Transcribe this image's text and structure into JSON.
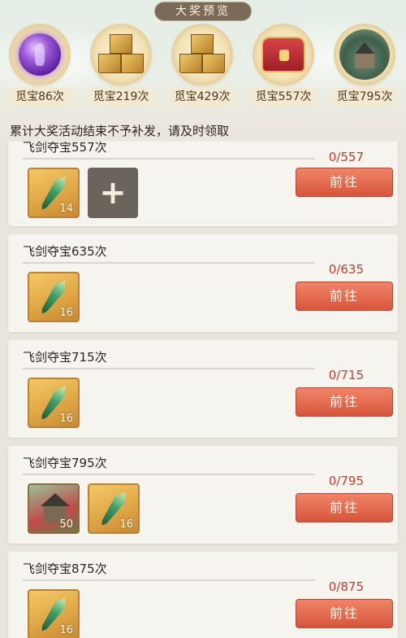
{
  "header": {
    "title": "大奖预览"
  },
  "prizes": [
    {
      "icon": "purple-orb-icon",
      "label": "觅宝86次"
    },
    {
      "icon": "gold-crates-icon",
      "label": "觅宝219次"
    },
    {
      "icon": "gold-crates-icon",
      "label": "觅宝429次"
    },
    {
      "icon": "red-chest-icon",
      "label": "觅宝557次"
    },
    {
      "icon": "pavilion-house-icon",
      "label": "觅宝795次"
    }
  ],
  "notice": "累计大奖活动结束不予补发，请及时领取",
  "tasks": [
    {
      "name": "飞剑夺宝557次",
      "progress": "0/557",
      "button": "前往",
      "items": [
        {
          "icon": "flying-sword-icon",
          "count": "14"
        }
      ],
      "add_slot": "+"
    },
    {
      "name": "飞剑夺宝635次",
      "progress": "0/635",
      "button": "前往",
      "items": [
        {
          "icon": "flying-sword-icon",
          "count": "16"
        }
      ]
    },
    {
      "name": "飞剑夺宝715次",
      "progress": "0/715",
      "button": "前往",
      "items": [
        {
          "icon": "flying-sword-icon",
          "count": "16"
        }
      ]
    },
    {
      "name": "飞剑夺宝795次",
      "progress": "0/795",
      "button": "前往",
      "items": [
        {
          "icon": "pavilion-house-icon",
          "count": "50"
        },
        {
          "icon": "flying-sword-icon",
          "count": "16"
        }
      ]
    },
    {
      "name": "飞剑夺宝875次",
      "progress": "0/875",
      "button": "前往",
      "items": [
        {
          "icon": "flying-sword-icon",
          "count": "16"
        }
      ]
    }
  ]
}
